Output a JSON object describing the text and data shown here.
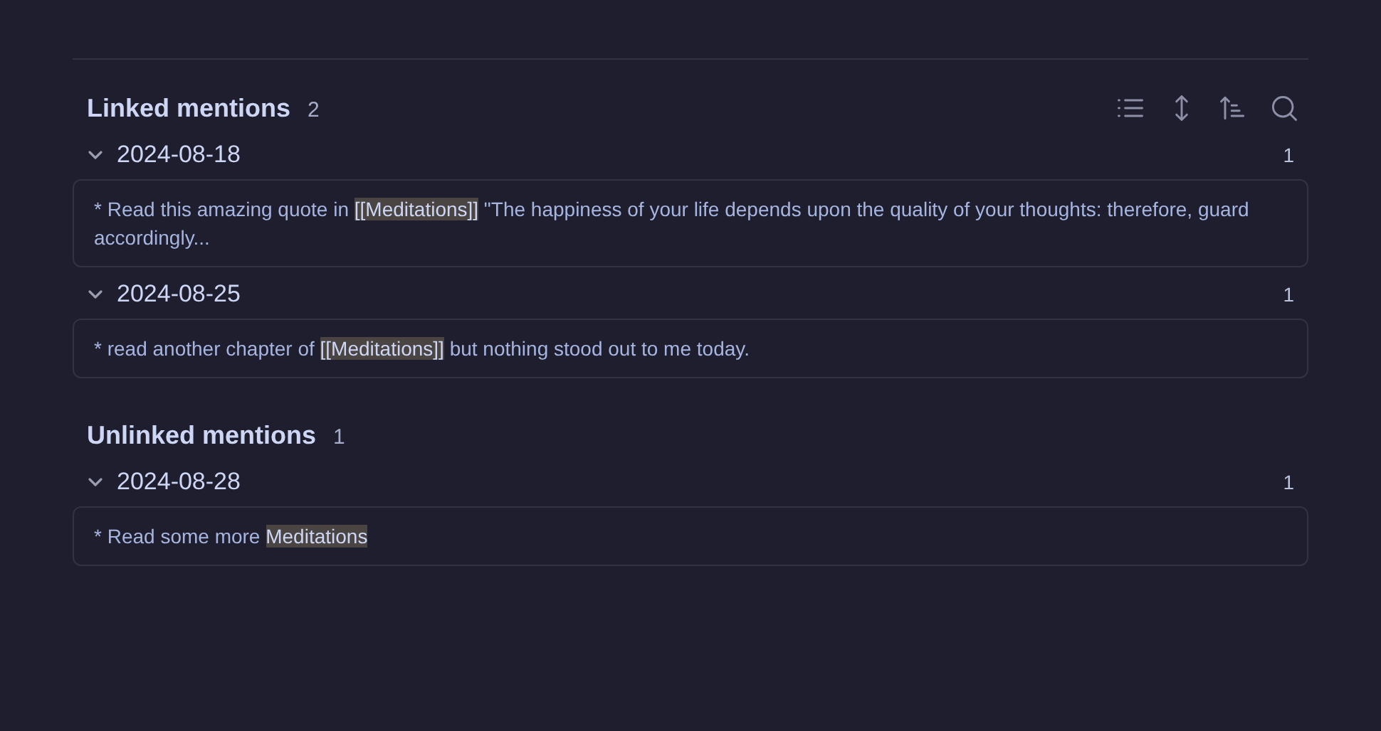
{
  "sections": [
    {
      "title": "Linked mentions",
      "count": "2",
      "toolbar": true,
      "groups": [
        {
          "date": "2024-08-18",
          "count": "1",
          "expanded": true,
          "snippet": [
            {
              "text": "* Read this amazing quote in ",
              "highlighted": false
            },
            {
              "text": "[[Meditations]]",
              "highlighted": true
            },
            {
              "text": " \"The happiness of your life depends upon the quality of your thoughts: therefore, guard accordingly...",
              "highlighted": false
            }
          ]
        },
        {
          "date": "2024-08-25",
          "count": "1",
          "expanded": true,
          "snippet": [
            {
              "text": "* read another chapter of ",
              "highlighted": false
            },
            {
              "text": "[[Meditations]]",
              "highlighted": true
            },
            {
              "text": " but nothing stood out to me today.",
              "highlighted": false
            }
          ]
        }
      ]
    },
    {
      "title": "Unlinked mentions",
      "count": "1",
      "toolbar": false,
      "groups": [
        {
          "date": "2024-08-28",
          "count": "1",
          "expanded": true,
          "snippet": [
            {
              "text": "* Read some more ",
              "highlighted": false
            },
            {
              "text": "Meditations",
              "highlighted": true
            }
          ]
        }
      ]
    }
  ]
}
